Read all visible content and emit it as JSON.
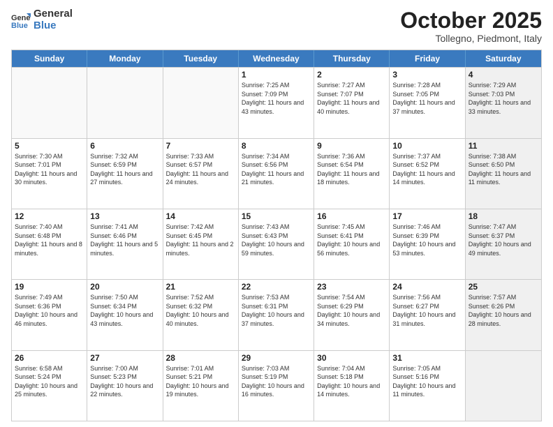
{
  "logo": {
    "general": "General",
    "blue": "Blue"
  },
  "title": "October 2025",
  "location": "Tollegno, Piedmont, Italy",
  "days_of_week": [
    "Sunday",
    "Monday",
    "Tuesday",
    "Wednesday",
    "Thursday",
    "Friday",
    "Saturday"
  ],
  "weeks": [
    [
      {
        "day": "",
        "sunrise": "",
        "sunset": "",
        "daylight": "",
        "empty": true
      },
      {
        "day": "",
        "sunrise": "",
        "sunset": "",
        "daylight": "",
        "empty": true
      },
      {
        "day": "",
        "sunrise": "",
        "sunset": "",
        "daylight": "",
        "empty": true
      },
      {
        "day": "1",
        "sunrise": "Sunrise: 7:25 AM",
        "sunset": "Sunset: 7:09 PM",
        "daylight": "Daylight: 11 hours and 43 minutes."
      },
      {
        "day": "2",
        "sunrise": "Sunrise: 7:27 AM",
        "sunset": "Sunset: 7:07 PM",
        "daylight": "Daylight: 11 hours and 40 minutes."
      },
      {
        "day": "3",
        "sunrise": "Sunrise: 7:28 AM",
        "sunset": "Sunset: 7:05 PM",
        "daylight": "Daylight: 11 hours and 37 minutes."
      },
      {
        "day": "4",
        "sunrise": "Sunrise: 7:29 AM",
        "sunset": "Sunset: 7:03 PM",
        "daylight": "Daylight: 11 hours and 33 minutes.",
        "shaded": true
      }
    ],
    [
      {
        "day": "5",
        "sunrise": "Sunrise: 7:30 AM",
        "sunset": "Sunset: 7:01 PM",
        "daylight": "Daylight: 11 hours and 30 minutes."
      },
      {
        "day": "6",
        "sunrise": "Sunrise: 7:32 AM",
        "sunset": "Sunset: 6:59 PM",
        "daylight": "Daylight: 11 hours and 27 minutes."
      },
      {
        "day": "7",
        "sunrise": "Sunrise: 7:33 AM",
        "sunset": "Sunset: 6:57 PM",
        "daylight": "Daylight: 11 hours and 24 minutes."
      },
      {
        "day": "8",
        "sunrise": "Sunrise: 7:34 AM",
        "sunset": "Sunset: 6:56 PM",
        "daylight": "Daylight: 11 hours and 21 minutes."
      },
      {
        "day": "9",
        "sunrise": "Sunrise: 7:36 AM",
        "sunset": "Sunset: 6:54 PM",
        "daylight": "Daylight: 11 hours and 18 minutes."
      },
      {
        "day": "10",
        "sunrise": "Sunrise: 7:37 AM",
        "sunset": "Sunset: 6:52 PM",
        "daylight": "Daylight: 11 hours and 14 minutes."
      },
      {
        "day": "11",
        "sunrise": "Sunrise: 7:38 AM",
        "sunset": "Sunset: 6:50 PM",
        "daylight": "Daylight: 11 hours and 11 minutes.",
        "shaded": true
      }
    ],
    [
      {
        "day": "12",
        "sunrise": "Sunrise: 7:40 AM",
        "sunset": "Sunset: 6:48 PM",
        "daylight": "Daylight: 11 hours and 8 minutes."
      },
      {
        "day": "13",
        "sunrise": "Sunrise: 7:41 AM",
        "sunset": "Sunset: 6:46 PM",
        "daylight": "Daylight: 11 hours and 5 minutes."
      },
      {
        "day": "14",
        "sunrise": "Sunrise: 7:42 AM",
        "sunset": "Sunset: 6:45 PM",
        "daylight": "Daylight: 11 hours and 2 minutes."
      },
      {
        "day": "15",
        "sunrise": "Sunrise: 7:43 AM",
        "sunset": "Sunset: 6:43 PM",
        "daylight": "Daylight: 10 hours and 59 minutes."
      },
      {
        "day": "16",
        "sunrise": "Sunrise: 7:45 AM",
        "sunset": "Sunset: 6:41 PM",
        "daylight": "Daylight: 10 hours and 56 minutes."
      },
      {
        "day": "17",
        "sunrise": "Sunrise: 7:46 AM",
        "sunset": "Sunset: 6:39 PM",
        "daylight": "Daylight: 10 hours and 53 minutes."
      },
      {
        "day": "18",
        "sunrise": "Sunrise: 7:47 AM",
        "sunset": "Sunset: 6:37 PM",
        "daylight": "Daylight: 10 hours and 49 minutes.",
        "shaded": true
      }
    ],
    [
      {
        "day": "19",
        "sunrise": "Sunrise: 7:49 AM",
        "sunset": "Sunset: 6:36 PM",
        "daylight": "Daylight: 10 hours and 46 minutes."
      },
      {
        "day": "20",
        "sunrise": "Sunrise: 7:50 AM",
        "sunset": "Sunset: 6:34 PM",
        "daylight": "Daylight: 10 hours and 43 minutes."
      },
      {
        "day": "21",
        "sunrise": "Sunrise: 7:52 AM",
        "sunset": "Sunset: 6:32 PM",
        "daylight": "Daylight: 10 hours and 40 minutes."
      },
      {
        "day": "22",
        "sunrise": "Sunrise: 7:53 AM",
        "sunset": "Sunset: 6:31 PM",
        "daylight": "Daylight: 10 hours and 37 minutes."
      },
      {
        "day": "23",
        "sunrise": "Sunrise: 7:54 AM",
        "sunset": "Sunset: 6:29 PM",
        "daylight": "Daylight: 10 hours and 34 minutes."
      },
      {
        "day": "24",
        "sunrise": "Sunrise: 7:56 AM",
        "sunset": "Sunset: 6:27 PM",
        "daylight": "Daylight: 10 hours and 31 minutes."
      },
      {
        "day": "25",
        "sunrise": "Sunrise: 7:57 AM",
        "sunset": "Sunset: 6:26 PM",
        "daylight": "Daylight: 10 hours and 28 minutes.",
        "shaded": true
      }
    ],
    [
      {
        "day": "26",
        "sunrise": "Sunrise: 6:58 AM",
        "sunset": "Sunset: 5:24 PM",
        "daylight": "Daylight: 10 hours and 25 minutes."
      },
      {
        "day": "27",
        "sunrise": "Sunrise: 7:00 AM",
        "sunset": "Sunset: 5:23 PM",
        "daylight": "Daylight: 10 hours and 22 minutes."
      },
      {
        "day": "28",
        "sunrise": "Sunrise: 7:01 AM",
        "sunset": "Sunset: 5:21 PM",
        "daylight": "Daylight: 10 hours and 19 minutes."
      },
      {
        "day": "29",
        "sunrise": "Sunrise: 7:03 AM",
        "sunset": "Sunset: 5:19 PM",
        "daylight": "Daylight: 10 hours and 16 minutes."
      },
      {
        "day": "30",
        "sunrise": "Sunrise: 7:04 AM",
        "sunset": "Sunset: 5:18 PM",
        "daylight": "Daylight: 10 hours and 14 minutes."
      },
      {
        "day": "31",
        "sunrise": "Sunrise: 7:05 AM",
        "sunset": "Sunset: 5:16 PM",
        "daylight": "Daylight: 10 hours and 11 minutes."
      },
      {
        "day": "",
        "sunrise": "",
        "sunset": "",
        "daylight": "",
        "empty": true,
        "shaded": true
      }
    ]
  ]
}
